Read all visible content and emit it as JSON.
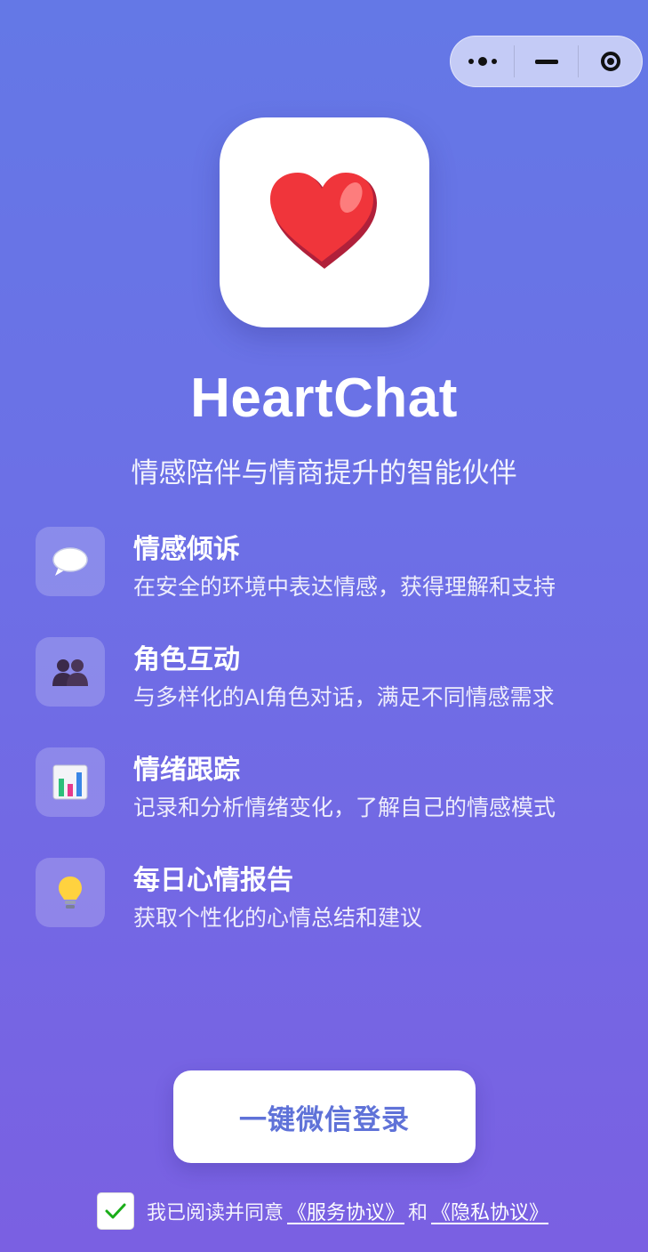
{
  "app": {
    "name": "HeartChat",
    "tagline": "情感陪伴与情商提升的智能伙伴"
  },
  "capsule": {
    "icons": [
      "more-dots-icon",
      "minimize-icon",
      "close-target-icon"
    ]
  },
  "features": [
    {
      "icon": "speech-bubble-icon",
      "title": "情感倾诉",
      "desc": "在安全的环境中表达情感，获得理解和支持"
    },
    {
      "icon": "people-icon",
      "title": "角色互动",
      "desc": "与多样化的AI角色对话，满足不同情感需求"
    },
    {
      "icon": "bar-chart-icon",
      "title": "情绪跟踪",
      "desc": "记录和分析情绪变化，了解自己的情感模式"
    },
    {
      "icon": "lightbulb-icon",
      "title": "每日心情报告",
      "desc": "获取个性化的心情总结和建议"
    }
  ],
  "login": {
    "button_label": "一键微信登录"
  },
  "agreement": {
    "checked": true,
    "prefix": "我已阅读并同意",
    "service_link": "《服务协议》",
    "conjunction": "和",
    "privacy_link": "《隐私协议》"
  },
  "colors": {
    "gradient_top": "#6478e6",
    "gradient_bottom": "#7a60e2",
    "button_text": "#5f72d8",
    "heart": "#f0353b"
  }
}
